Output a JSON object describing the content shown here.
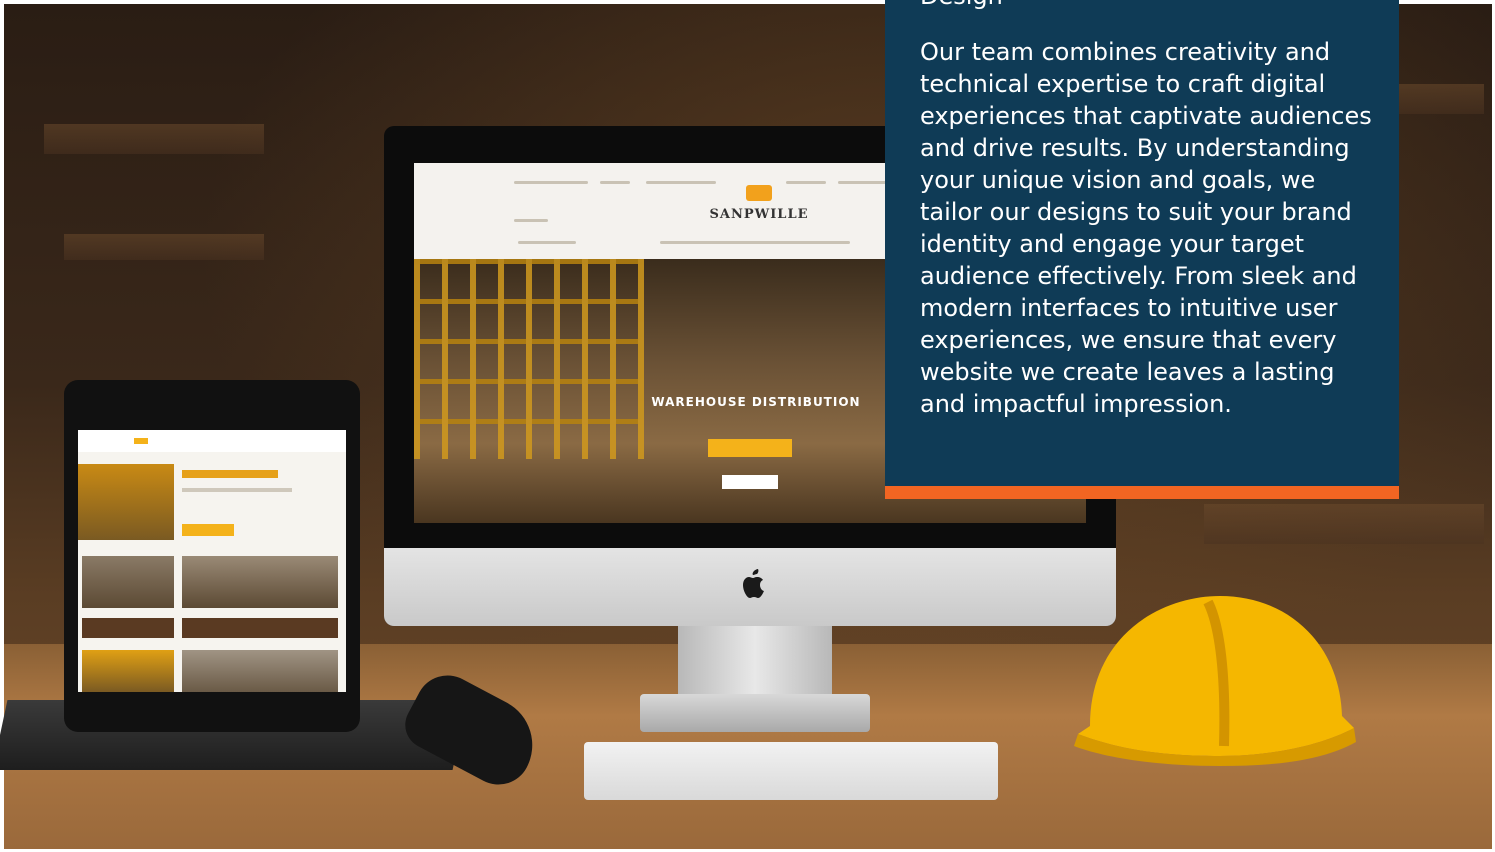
{
  "panel": {
    "heading": "Design",
    "body": "Our team combines creativity and technical expertise to craft digital experiences that captivate audiences and drive results. By understanding your unique vision and goals, we tailor our designs to suit your brand identity and engage your target audience effectively. From sleek and modern interfaces to intuitive user experiences, we ensure that every website we create leaves a lasting and impactful impression."
  },
  "monitor_site": {
    "logo_text": "SANPWILLE",
    "hero_text": "WAREHOUSE DISTRIBUTION"
  },
  "colors": {
    "panel_bg": "#0f3b56",
    "panel_accent": "#f26522",
    "brand_yellow": "#f4b21a"
  },
  "icons": {
    "apple_logo": "apple-logo-icon"
  }
}
